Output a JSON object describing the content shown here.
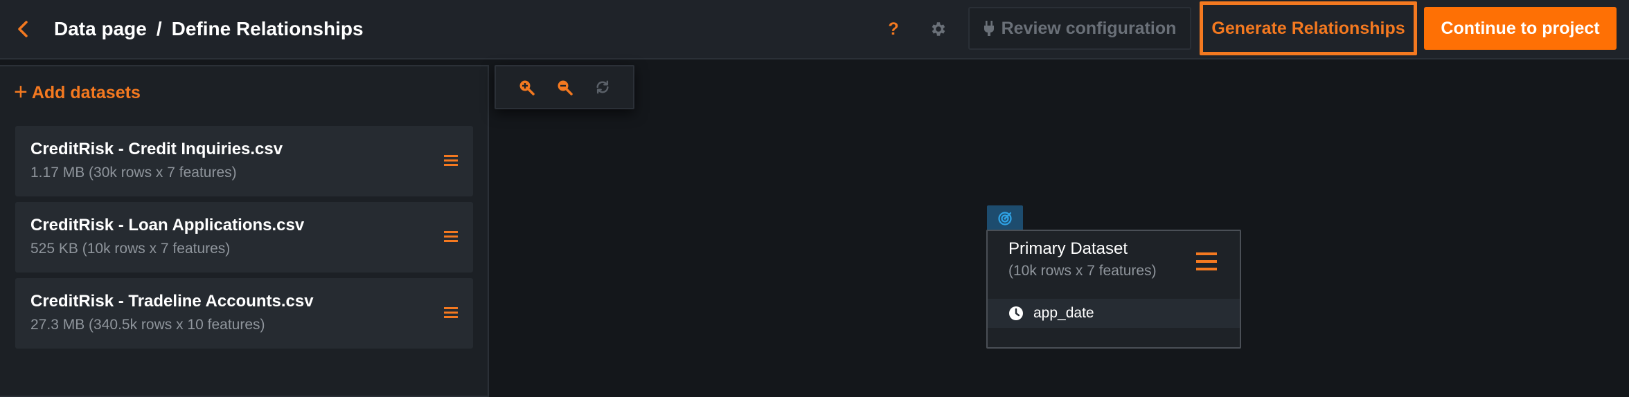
{
  "header": {
    "breadcrumb_parent": "Data page",
    "breadcrumb_separator": "/",
    "breadcrumb_current": "Define Relationships",
    "help_label": "?",
    "review_label": "Review configuration",
    "generate_label": "Generate Relationships",
    "continue_label": "Continue to project",
    "icons": {
      "back": "chevron-left-icon",
      "settings": "gear-icon",
      "review": "plug-icon"
    }
  },
  "sidebar": {
    "add_label": "Add datasets",
    "datasets": [
      {
        "name": "CreditRisk - Credit Inquiries.csv",
        "meta": "1.17 MB (30k rows x 7 features)"
      },
      {
        "name": "CreditRisk - Loan Applications.csv",
        "meta": "525 KB (10k rows x 7 features)"
      },
      {
        "name": "CreditRisk - Tradeline Accounts.csv",
        "meta": "27.3 MB (340.5k rows x 10 features)"
      }
    ]
  },
  "toolbar": {
    "icons": [
      "zoom-in-icon",
      "zoom-out-icon",
      "refresh-icon"
    ]
  },
  "canvas": {
    "primary": {
      "title": "Primary Dataset",
      "subtitle": "(10k rows x 7 features)",
      "feature": "app_date",
      "icon": "target-icon"
    }
  },
  "colors": {
    "accent": "#f47920",
    "primary_button": "#fe7005",
    "background": "#14171b",
    "panel": "#1c2025",
    "target_tab": "#1d4c6e"
  }
}
